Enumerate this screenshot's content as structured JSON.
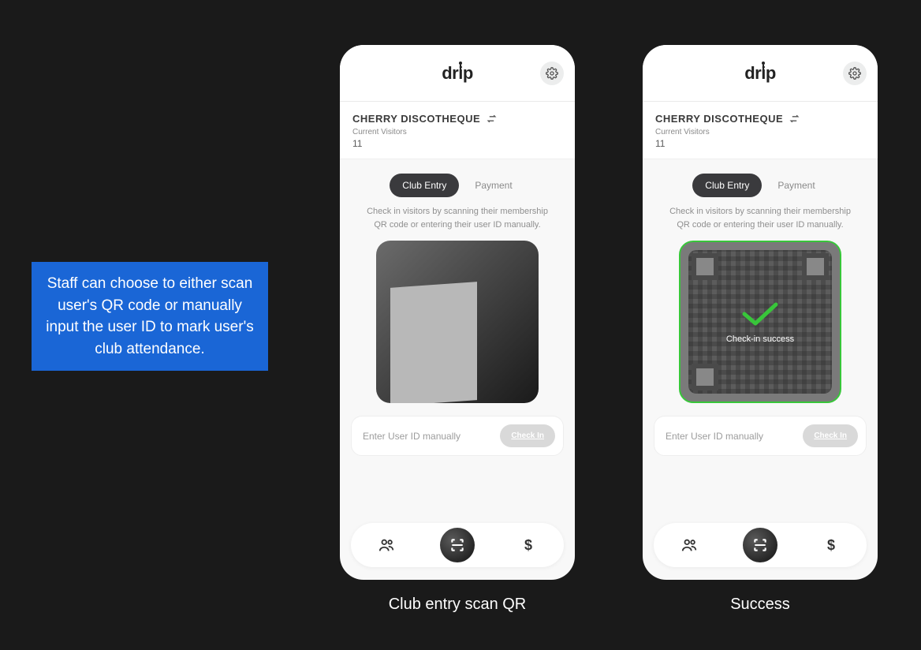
{
  "callout_text": "Staff can choose to either scan user's QR code or manually input the user ID to mark user's club attendance.",
  "logo": "drip",
  "venue": {
    "name": "CHERRY DISCOTHEQUE",
    "sub_label": "Current Visitors",
    "count": "11"
  },
  "tabs": {
    "entry": "Club Entry",
    "payment": "Payment"
  },
  "help_text": "Check in visitors by scanning their membership QR code or entering their user ID manually.",
  "input": {
    "placeholder": "Enter User ID manually",
    "button": "Check In"
  },
  "success_text": "Check-in success",
  "captions": {
    "left": "Club entry scan QR",
    "right": "Success"
  },
  "icons": {
    "gear": "gear-icon",
    "swap": "swap-icon",
    "people": "people-icon",
    "scan": "scan-icon",
    "dollar": "dollar-icon",
    "check": "check-icon"
  },
  "colors": {
    "accent_blue": "#1a66d6",
    "success_green": "#38c63a"
  }
}
